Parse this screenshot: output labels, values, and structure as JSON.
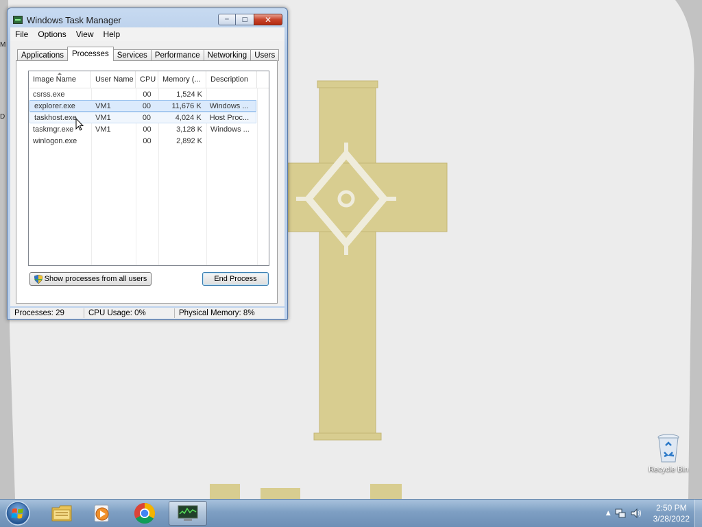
{
  "window": {
    "title": "Windows Task Manager",
    "menu": [
      "File",
      "Options",
      "View",
      "Help"
    ],
    "tabs": [
      "Applications",
      "Processes",
      "Services",
      "Performance",
      "Networking",
      "Users"
    ],
    "active_tab": "Processes",
    "columns": [
      "Image Name",
      "User Name",
      "CPU",
      "Memory (...",
      "Description"
    ],
    "processes": [
      {
        "image": "csrss.exe",
        "user": "",
        "cpu": "00",
        "memory": "1,524 K",
        "description": ""
      },
      {
        "image": "explorer.exe",
        "user": "VM1",
        "cpu": "00",
        "memory": "11,676 K",
        "description": "Windows ..."
      },
      {
        "image": "taskhost.exe",
        "user": "VM1",
        "cpu": "00",
        "memory": "4,024 K",
        "description": "Host Proc..."
      },
      {
        "image": "taskmgr.exe",
        "user": "VM1",
        "cpu": "00",
        "memory": "3,128 K",
        "description": "Windows ..."
      },
      {
        "image": "winlogon.exe",
        "user": "",
        "cpu": "00",
        "memory": "2,892 K",
        "description": ""
      }
    ],
    "selected_process": "explorer.exe",
    "hovered_process": "taskhost.exe",
    "show_all_label": "Show processes from all users",
    "end_process_label": "End Process",
    "status": {
      "processes": "Processes: 29",
      "cpu": "CPU Usage: 0%",
      "memory": "Physical Memory: 8%"
    }
  },
  "desktop": {
    "icons": [
      {
        "label": "Recycle Bin",
        "icon": "recycle-bin-icon"
      }
    ],
    "edge_letters": [
      "M",
      "D"
    ]
  },
  "taskbar": {
    "pinned": [
      {
        "name": "windows-explorer",
        "icon": "folder-icon"
      },
      {
        "name": "media-player",
        "icon": "media-player-icon"
      },
      {
        "name": "chrome",
        "icon": "chrome-icon"
      },
      {
        "name": "task-manager",
        "icon": "task-manager-icon",
        "active": true
      }
    ],
    "clock": {
      "time": "2:50 PM",
      "date": "3/28/2022"
    }
  },
  "colors": {
    "window_frame": "#bdd2ed",
    "selection": "#dbeafc",
    "taskbar": "#7e9fc3",
    "wall_cross": "#d8cd90"
  }
}
